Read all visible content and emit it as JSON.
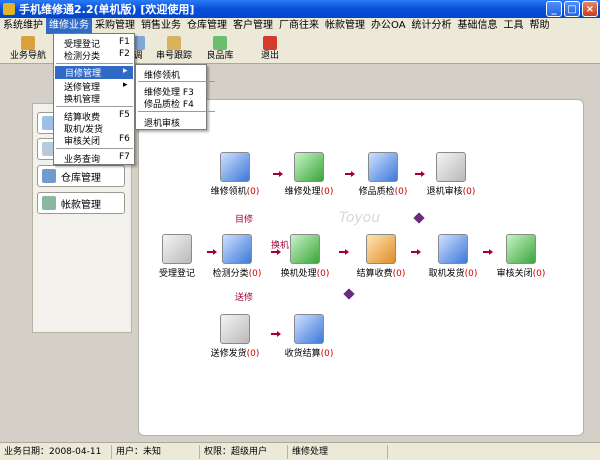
{
  "window": {
    "title": "手机维修通2.2(单机版) [欢迎使用]",
    "buttons": [
      "_",
      "□",
      "×"
    ]
  },
  "menubar": [
    "系统维护",
    "维修业务",
    "采购管理",
    "销售业务",
    "仓库管理",
    "客户管理",
    "厂商往来",
    "帐款管理",
    "办公OA",
    "统计分析",
    "基础信息",
    "工具",
    "帮助"
  ],
  "toolbar": [
    {
      "label": "业务导航",
      "icon": "navigation-icon"
    },
    {
      "label": "调",
      "icon": "query-icon"
    },
    {
      "label": "串号跟踪",
      "icon": "track-icon"
    },
    {
      "label": "良品库",
      "icon": "good-stock-icon"
    },
    {
      "label": "退出",
      "icon": "exit-icon"
    }
  ],
  "dropdown": {
    "items": [
      {
        "label": "受理登记",
        "key": "F1"
      },
      {
        "label": "检测分类",
        "key": "F2"
      },
      {
        "label": "目修管理",
        "key": "",
        "active": true
      },
      {
        "label": "送修管理",
        "key": ""
      },
      {
        "label": "换机管理",
        "key": ""
      },
      {
        "label": "结算收费",
        "key": "F5"
      },
      {
        "label": "取机/发货",
        "key": ""
      },
      {
        "label": "审核关闭",
        "key": "F6"
      },
      {
        "label": "业务查询",
        "key": "F7"
      }
    ],
    "submenu": [
      {
        "label": "维修领机",
        "key": ""
      },
      {
        "label": "维修处理",
        "key": "F3"
      },
      {
        "label": "修品质检",
        "key": "F4"
      },
      {
        "label": "退机审核",
        "key": ""
      }
    ]
  },
  "leftpanel": [
    "仓库管理",
    "帐款管理"
  ],
  "watermark": "Toyou",
  "flow": {
    "nodes": [
      {
        "id": "wx",
        "label": "维修领机",
        "count": "(0)"
      },
      {
        "id": "cl",
        "label": "维修处理",
        "count": "(0)"
      },
      {
        "id": "zj",
        "label": "修品质检",
        "count": "(0)"
      },
      {
        "id": "sh",
        "label": "退机审核",
        "count": "(0)"
      },
      {
        "id": "dj",
        "label": "受理登记",
        "count": ""
      },
      {
        "id": "jc",
        "label": "检测分类",
        "count": "(0)"
      },
      {
        "id": "hj",
        "label": "换机处理",
        "count": "(0)"
      },
      {
        "id": "js",
        "label": "结算收费",
        "count": "(0)"
      },
      {
        "id": "qj",
        "label": "取机发货",
        "count": "(0)"
      },
      {
        "id": "gb",
        "label": "审核关闭",
        "count": "(0)"
      },
      {
        "id": "sx",
        "label": "送修发货",
        "count": "(0)"
      },
      {
        "id": "sj",
        "label": "收货结算",
        "count": "(0)"
      }
    ],
    "labels": {
      "self": "目修",
      "swap": "换机",
      "send": "送修"
    }
  },
  "status": {
    "date_label": "业务日期：2008-04-11",
    "user_label": "用户：未知",
    "role_label": "权限：超级用户",
    "mode": "维修处理"
  }
}
